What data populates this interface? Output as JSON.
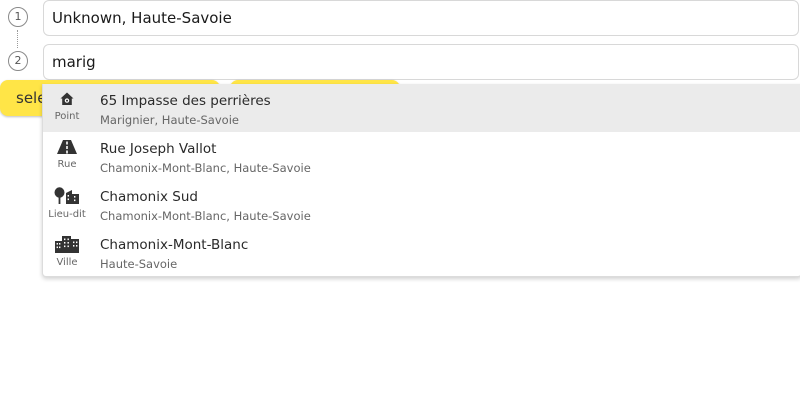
{
  "route": {
    "steps": [
      {
        "number": "1",
        "value": "Unknown, Haute-Savoie",
        "placeholder": ""
      },
      {
        "number": "2",
        "value": "marig",
        "placeholder": ""
      }
    ]
  },
  "buttons": {
    "select_label": "select"
  },
  "suggestions": [
    {
      "title": "65 Impasse des perrières",
      "subtitle": "Marignier, Haute-Savoie",
      "type": "Point",
      "icon": "address-point-icon",
      "active": true
    },
    {
      "title": "Rue Joseph Vallot",
      "subtitle": "Chamonix-Mont-Blanc, Haute-Savoie",
      "type": "Rue",
      "icon": "road-icon",
      "active": false
    },
    {
      "title": "Chamonix Sud",
      "subtitle": "Chamonix-Mont-Blanc, Haute-Savoie",
      "type": "Lieu-dit",
      "icon": "locality-icon",
      "active": false
    },
    {
      "title": "Chamonix-Mont-Blanc",
      "subtitle": "Haute-Savoie",
      "type": "Ville",
      "icon": "city-icon",
      "active": false
    }
  ],
  "colors": {
    "accent": "#ffe547",
    "active_row": "#ebebeb",
    "icon": "#333333"
  }
}
